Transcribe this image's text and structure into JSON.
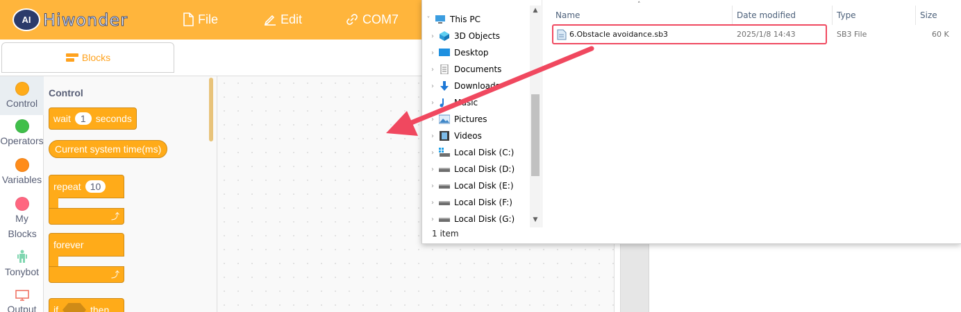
{
  "app": {
    "logo_badge": "AI",
    "logo_text": "Hiwonder",
    "menu": {
      "file": "File",
      "edit": "Edit",
      "port": "COM7"
    },
    "tab_blocks": "Blocks",
    "categories": [
      {
        "label": "Control",
        "color": "#ffab19"
      },
      {
        "label": "Operators",
        "color": "#40bf4a"
      },
      {
        "label": "Variables",
        "color": "#ff8c1a"
      },
      {
        "label": "My Blocks",
        "color": "#ff6680"
      },
      {
        "label": "Tonybot",
        "icon": "robot-icon"
      },
      {
        "label": "Output",
        "icon": "monitor-icon"
      }
    ],
    "palette": {
      "title": "Control",
      "wait_prefix": "wait",
      "wait_value": "1",
      "wait_suffix": "seconds",
      "system_time": "Current system time(ms)",
      "repeat_label": "repeat",
      "repeat_value": "10",
      "forever_label": "forever",
      "if_label": "if",
      "then_label": "then",
      "loop_arrow": "⤴"
    }
  },
  "explorer": {
    "nav": [
      {
        "label": "This PC",
        "icon": "pc-icon",
        "expand": "˅"
      },
      {
        "label": "3D Objects",
        "icon": "3d-objects-icon",
        "expand": "›"
      },
      {
        "label": "Desktop",
        "icon": "desktop-icon",
        "expand": "›"
      },
      {
        "label": "Documents",
        "icon": "documents-icon",
        "expand": "›"
      },
      {
        "label": "Downloads",
        "icon": "downloads-icon",
        "expand": "›"
      },
      {
        "label": "Music",
        "icon": "music-icon",
        "expand": "›"
      },
      {
        "label": "Pictures",
        "icon": "pictures-icon",
        "expand": "›"
      },
      {
        "label": "Videos",
        "icon": "videos-icon",
        "expand": "›"
      },
      {
        "label": "Local Disk (C:)",
        "icon": "drive-c-icon",
        "expand": "›"
      },
      {
        "label": "Local Disk (D:)",
        "icon": "drive-icon",
        "expand": "›"
      },
      {
        "label": "Local Disk (E:)",
        "icon": "drive-icon",
        "expand": "›"
      },
      {
        "label": "Local Disk (F:)",
        "icon": "drive-icon",
        "expand": "›"
      },
      {
        "label": "Local Disk (G:)",
        "icon": "drive-icon",
        "expand": "›"
      }
    ],
    "columns": {
      "name": "Name",
      "date": "Date modified",
      "type": "Type",
      "size": "Size"
    },
    "files": [
      {
        "name": "6.Obstacle avoidance.sb3",
        "date": "2025/1/8 14:43",
        "type": "SB3 File",
        "size": "60 K"
      }
    ],
    "status": "1 item",
    "highlight_color": "#f0485f"
  }
}
